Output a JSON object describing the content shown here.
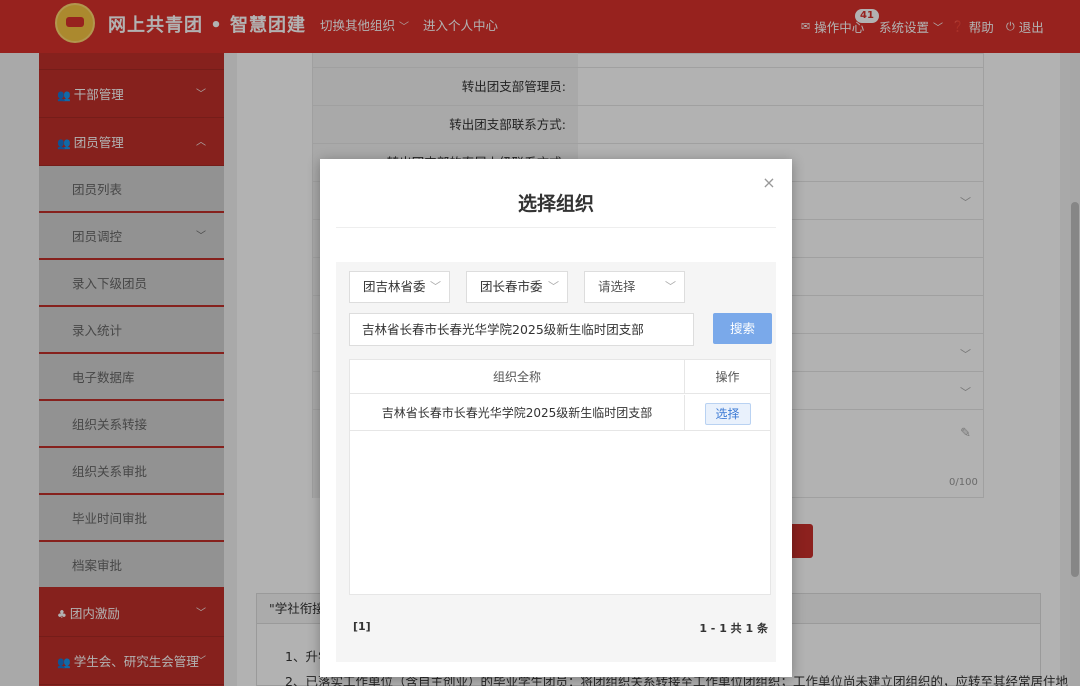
{
  "header": {
    "brand": "网上共青团 • 智慧团建",
    "switch_org": "切换其他组织",
    "personal_center": "进入个人中心",
    "ops_center": "操作中心",
    "ops_badge": "41",
    "system_settings": "系统设置",
    "help": "帮助",
    "logout": "退出"
  },
  "sidebar": {
    "items": [
      {
        "label": "干部管理"
      },
      {
        "label": "团员管理"
      }
    ],
    "sub_items": [
      {
        "label": "团员列表"
      },
      {
        "label": "团员调控"
      },
      {
        "label": "录入下级团员"
      },
      {
        "label": "录入统计"
      },
      {
        "label": "电子数据库"
      },
      {
        "label": "组织关系转接"
      },
      {
        "label": "组织关系审批"
      },
      {
        "label": "毕业时间审批"
      },
      {
        "label": "档案审批"
      }
    ],
    "bottom_items": [
      {
        "label": "团内激励"
      },
      {
        "label": "学生会、研究生会管理"
      }
    ]
  },
  "form": {
    "row_admin_label": "转出团支部管理员:",
    "row_contact_label": "转出团支部联系方式:",
    "row_partial_label": "转出团支部的直属上级联系方式:",
    "char_count": "0/100"
  },
  "notice": {
    "heading": "\"学社衔接\"",
    "line1": "1、升学",
    "line2": "2、已落实工作单位（含自主创业）的毕业学生团员：将团组织关系转接至工作单位团组织；工作单位尚未建立团组织的，应转至其经常居住地"
  },
  "modal": {
    "title": "选择组织",
    "close_icon": "×",
    "select_province": "团吉林省委",
    "select_city": "团长春市委",
    "select_other": "请选择",
    "search_value": "吉林省长春市长春光华学院2025级新生临时团支部",
    "search_button": "搜索",
    "table": {
      "headers": [
        "组织全称",
        "操作"
      ],
      "rows": [
        {
          "name": "吉林省长春市长春光华学院2025级新生临时团支部",
          "action": "选择"
        }
      ]
    },
    "pager_left": "[1]",
    "pager_right": "1 - 1  共 1 条"
  }
}
